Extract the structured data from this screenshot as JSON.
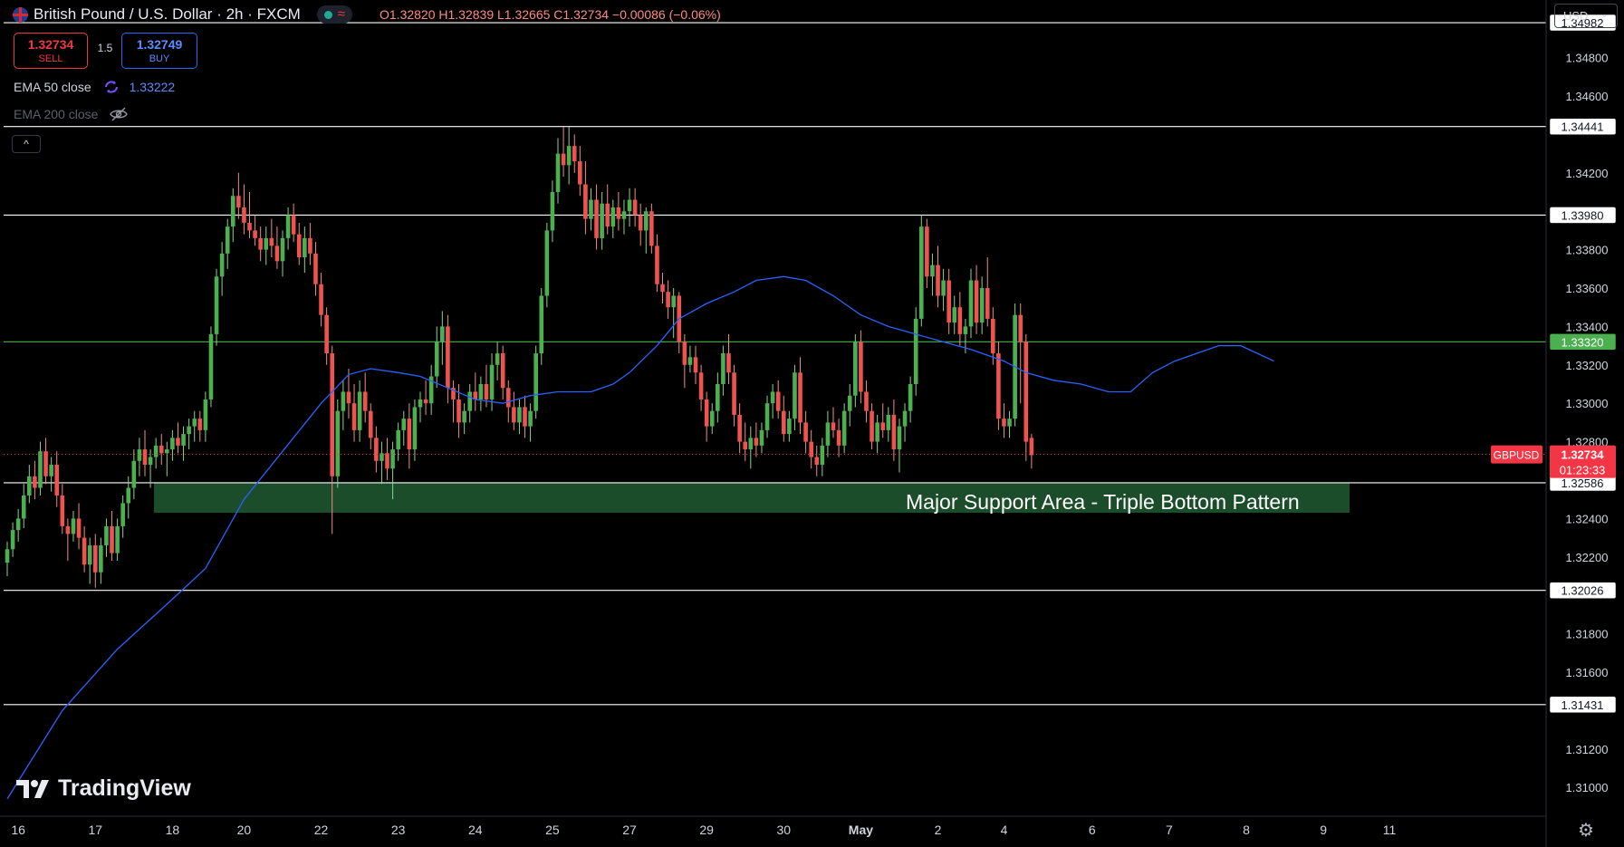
{
  "header": {
    "symbol_title": "British Pound / U.S. Dollar · 2h · FXCM",
    "ohlc_o": "O1.32820",
    "ohlc_h": "H1.32839",
    "ohlc_l": "L1.32665",
    "ohlc_c": "C1.32734",
    "ohlc_change": "−0.00086 (−0.06%)",
    "status_icon": "market-open-dot",
    "wave_icon": "wave-icon"
  },
  "trade": {
    "sell_price": "1.32734",
    "sell_label": "SELL",
    "spread": "1.5",
    "buy_price": "1.32749",
    "buy_label": "BUY"
  },
  "indicators": [
    {
      "name": "EMA 50 close",
      "value": "1.33222",
      "icon": "sync-icon",
      "color": "#2962ff"
    },
    {
      "name": "EMA 200 close",
      "value": "",
      "icon": "eye-hidden-icon",
      "color": "#5d606b"
    }
  ],
  "currency": "USD",
  "branding": "TradingView",
  "colors": {
    "up": "#26a69a",
    "up_fill": "#4caf50",
    "down": "#ef5350",
    "ema": "#2962ff",
    "support": "#1b4d2a",
    "price_tag": "#f23645"
  },
  "chart_data": {
    "type": "candlestick",
    "title": "British Pound / U.S. Dollar · 2h · FXCM",
    "ylim": [
      1.3085,
      1.351
    ],
    "y_ticks": [
      "1.34800",
      "1.34600",
      "1.34200",
      "1.33800",
      "1.33600",
      "1.33400",
      "1.33200",
      "1.33000",
      "1.32800",
      "1.32400",
      "1.32200",
      "1.31800",
      "1.31600",
      "1.31200",
      "1.31000"
    ],
    "y_tick_values": [
      1.348,
      1.346,
      1.342,
      1.338,
      1.336,
      1.334,
      1.332,
      1.33,
      1.328,
      1.324,
      1.322,
      1.318,
      1.316,
      1.312,
      1.31
    ],
    "x_ticks": [
      "16",
      "17",
      "18",
      "20",
      "22",
      "23",
      "24",
      "25",
      "27",
      "29",
      "30",
      "May",
      "2",
      "4",
      "6",
      "7",
      "8",
      "9",
      "11"
    ],
    "x_tick_index": [
      2,
      16,
      30,
      43,
      57,
      71,
      85,
      99,
      113,
      127,
      141,
      155,
      169,
      181,
      197,
      211,
      225,
      239,
      251
    ],
    "horizontal_levels": [
      {
        "value": 1.34982,
        "label": "1.34982",
        "color": "#ffffff"
      },
      {
        "value": 1.34441,
        "label": "1.34441",
        "color": "#ffffff"
      },
      {
        "value": 1.3398,
        "label": "1.33980",
        "color": "#ffffff"
      },
      {
        "value": 1.3332,
        "label": "1.33320",
        "color": "#4caf50"
      },
      {
        "value": 1.32586,
        "label": "1.32586",
        "color": "#ffffff"
      },
      {
        "value": 1.32026,
        "label": "1.32026",
        "color": "#ffffff"
      },
      {
        "value": 1.31431,
        "label": "1.31431",
        "color": "#ffffff"
      }
    ],
    "current_price": {
      "symbol": "GBPUSD",
      "value": 1.32734,
      "label": "1.32734",
      "countdown": "01:23:33"
    },
    "support_zone": {
      "from": 1.3243,
      "to": 1.32586,
      "label": "Major Support Area - Triple Bottom Pattern"
    },
    "candles": [
      [
        1.3217,
        1.3228,
        1.321,
        1.3224
      ],
      [
        1.3224,
        1.3238,
        1.322,
        1.3234
      ],
      [
        1.3234,
        1.3245,
        1.3228,
        1.324
      ],
      [
        1.324,
        1.3258,
        1.3235,
        1.3252
      ],
      [
        1.3252,
        1.3268,
        1.3248,
        1.3262
      ],
      [
        1.3262,
        1.327,
        1.325,
        1.3256
      ],
      [
        1.3256,
        1.328,
        1.3252,
        1.3275
      ],
      [
        1.3275,
        1.3282,
        1.3258,
        1.3262
      ],
      [
        1.3262,
        1.3272,
        1.3254,
        1.3268
      ],
      [
        1.3268,
        1.3275,
        1.3246,
        1.3252
      ],
      [
        1.3252,
        1.3258,
        1.3232,
        1.3236
      ],
      [
        1.3236,
        1.324,
        1.3218,
        1.3232
      ],
      [
        1.3232,
        1.3244,
        1.3228,
        1.324
      ],
      [
        1.324,
        1.3248,
        1.3224,
        1.323
      ],
      [
        1.323,
        1.3236,
        1.3212,
        1.3216
      ],
      [
        1.3216,
        1.323,
        1.3206,
        1.3226
      ],
      [
        1.3226,
        1.3232,
        1.3204,
        1.3212
      ],
      [
        1.3212,
        1.323,
        1.3206,
        1.3226
      ],
      [
        1.3226,
        1.324,
        1.322,
        1.3236
      ],
      [
        1.3236,
        1.3244,
        1.3218,
        1.3222
      ],
      [
        1.3222,
        1.324,
        1.3218,
        1.3236
      ],
      [
        1.3236,
        1.3252,
        1.323,
        1.3248
      ],
      [
        1.3248,
        1.3262,
        1.324,
        1.3256
      ],
      [
        1.3256,
        1.3276,
        1.325,
        1.327
      ],
      [
        1.327,
        1.3282,
        1.3262,
        1.3276
      ],
      [
        1.3276,
        1.3286,
        1.3262,
        1.3268
      ],
      [
        1.3268,
        1.3276,
        1.3256,
        1.3272
      ],
      [
        1.3272,
        1.3282,
        1.3266,
        1.3278
      ],
      [
        1.3278,
        1.3284,
        1.3268,
        1.3274
      ],
      [
        1.3274,
        1.328,
        1.3262,
        1.3276
      ],
      [
        1.3276,
        1.3286,
        1.327,
        1.3282
      ],
      [
        1.3282,
        1.329,
        1.3274,
        1.3278
      ],
      [
        1.3278,
        1.3288,
        1.327,
        1.3284
      ],
      [
        1.3284,
        1.3292,
        1.3276,
        1.3288
      ],
      [
        1.3288,
        1.3296,
        1.328,
        1.3292
      ],
      [
        1.3292,
        1.3296,
        1.328,
        1.3286
      ],
      [
        1.3286,
        1.3306,
        1.328,
        1.3302
      ],
      [
        1.3302,
        1.334,
        1.3298,
        1.3336
      ],
      [
        1.3336,
        1.337,
        1.333,
        1.3366
      ],
      [
        1.3366,
        1.3384,
        1.3356,
        1.3378
      ],
      [
        1.3378,
        1.3396,
        1.337,
        1.3392
      ],
      [
        1.3392,
        1.3412,
        1.3384,
        1.3408
      ],
      [
        1.3408,
        1.342,
        1.3396,
        1.3402
      ],
      [
        1.3402,
        1.3414,
        1.3388,
        1.3394
      ],
      [
        1.3394,
        1.341,
        1.3386,
        1.339
      ],
      [
        1.339,
        1.3398,
        1.3382,
        1.3386
      ],
      [
        1.3386,
        1.3392,
        1.3374,
        1.338
      ],
      [
        1.338,
        1.3392,
        1.3372,
        1.3386
      ],
      [
        1.3386,
        1.3396,
        1.3376,
        1.3382
      ],
      [
        1.3382,
        1.3392,
        1.337,
        1.3374
      ],
      [
        1.3374,
        1.339,
        1.3366,
        1.3386
      ],
      [
        1.3386,
        1.3402,
        1.338,
        1.3398
      ],
      [
        1.3398,
        1.3404,
        1.3384,
        1.3388
      ],
      [
        1.3388,
        1.3394,
        1.3372,
        1.3376
      ],
      [
        1.3376,
        1.3392,
        1.3368,
        1.3386
      ],
      [
        1.3386,
        1.3394,
        1.3372,
        1.3378
      ],
      [
        1.3378,
        1.3384,
        1.3356,
        1.3362
      ],
      [
        1.3362,
        1.3368,
        1.334,
        1.3346
      ],
      [
        1.3346,
        1.335,
        1.332,
        1.3326
      ],
      [
        1.3326,
        1.333,
        1.3232,
        1.3262
      ],
      [
        1.3262,
        1.3302,
        1.3256,
        1.3296
      ],
      [
        1.3296,
        1.3312,
        1.3286,
        1.3306
      ],
      [
        1.3306,
        1.3318,
        1.3292,
        1.33
      ],
      [
        1.33,
        1.331,
        1.328,
        1.3286
      ],
      [
        1.3286,
        1.3312,
        1.328,
        1.3306
      ],
      [
        1.3306,
        1.3316,
        1.329,
        1.3296
      ],
      [
        1.3296,
        1.33,
        1.3276,
        1.3282
      ],
      [
        1.3282,
        1.3288,
        1.3264,
        1.327
      ],
      [
        1.327,
        1.328,
        1.3258,
        1.3274
      ],
      [
        1.3274,
        1.3282,
        1.326,
        1.3266
      ],
      [
        1.3266,
        1.328,
        1.325,
        1.3276
      ],
      [
        1.3276,
        1.329,
        1.327,
        1.3286
      ],
      [
        1.3286,
        1.3296,
        1.3278,
        1.3292
      ],
      [
        1.3292,
        1.33,
        1.3266,
        1.3276
      ],
      [
        1.3276,
        1.3302,
        1.327,
        1.3298
      ],
      [
        1.3298,
        1.3306,
        1.329,
        1.3302
      ],
      [
        1.3302,
        1.3312,
        1.3294,
        1.33
      ],
      [
        1.33,
        1.332,
        1.3294,
        1.3314
      ],
      [
        1.3314,
        1.334,
        1.3308,
        1.3332
      ],
      [
        1.3332,
        1.3348,
        1.332,
        1.334
      ],
      [
        1.334,
        1.3346,
        1.33,
        1.3308
      ],
      [
        1.3308,
        1.3312,
        1.329,
        1.3302
      ],
      [
        1.3302,
        1.331,
        1.3282,
        1.329
      ],
      [
        1.329,
        1.33,
        1.3284,
        1.3296
      ],
      [
        1.3296,
        1.331,
        1.329,
        1.3306
      ],
      [
        1.3306,
        1.3316,
        1.3296,
        1.3302
      ],
      [
        1.3302,
        1.3314,
        1.3296,
        1.331
      ],
      [
        1.331,
        1.332,
        1.3298,
        1.3302
      ],
      [
        1.3302,
        1.3326,
        1.3296,
        1.332
      ],
      [
        1.332,
        1.3332,
        1.3312,
        1.3326
      ],
      [
        1.3326,
        1.333,
        1.3302,
        1.3308
      ],
      [
        1.3308,
        1.3312,
        1.329,
        1.3298
      ],
      [
        1.3298,
        1.3306,
        1.3286,
        1.329
      ],
      [
        1.329,
        1.3302,
        1.3284,
        1.3298
      ],
      [
        1.3298,
        1.3304,
        1.3282,
        1.3288
      ],
      [
        1.3288,
        1.33,
        1.328,
        1.3296
      ],
      [
        1.3296,
        1.333,
        1.3292,
        1.3326
      ],
      [
        1.3326,
        1.336,
        1.332,
        1.3356
      ],
      [
        1.3356,
        1.3394,
        1.335,
        1.339
      ],
      [
        1.339,
        1.3416,
        1.3384,
        1.341
      ],
      [
        1.341,
        1.3438,
        1.3404,
        1.343
      ],
      [
        1.343,
        1.3444,
        1.3418,
        1.3424
      ],
      [
        1.3424,
        1.3444,
        1.3414,
        1.3434
      ],
      [
        1.3434,
        1.344,
        1.342,
        1.3426
      ],
      [
        1.3426,
        1.3434,
        1.3408,
        1.3414
      ],
      [
        1.3414,
        1.3426,
        1.3388,
        1.3396
      ],
      [
        1.3396,
        1.3412,
        1.339,
        1.3406
      ],
      [
        1.3406,
        1.3414,
        1.338,
        1.3386
      ],
      [
        1.3386,
        1.341,
        1.338,
        1.3404
      ],
      [
        1.3404,
        1.3414,
        1.3388,
        1.3392
      ],
      [
        1.3392,
        1.3406,
        1.3386,
        1.3402
      ],
      [
        1.3402,
        1.341,
        1.339,
        1.3396
      ],
      [
        1.3396,
        1.3406,
        1.3388,
        1.34
      ],
      [
        1.34,
        1.3412,
        1.3392,
        1.3406
      ],
      [
        1.3406,
        1.3412,
        1.3392,
        1.3398
      ],
      [
        1.3398,
        1.3404,
        1.3382,
        1.339
      ],
      [
        1.339,
        1.3402,
        1.3378,
        1.34
      ],
      [
        1.34,
        1.3404,
        1.3378,
        1.3382
      ],
      [
        1.3382,
        1.3388,
        1.3358,
        1.3362
      ],
      [
        1.3362,
        1.3368,
        1.3352,
        1.3358
      ],
      [
        1.3358,
        1.3364,
        1.3344,
        1.335
      ],
      [
        1.335,
        1.336,
        1.3334,
        1.3356
      ],
      [
        1.3356,
        1.3358,
        1.3326,
        1.3332
      ],
      [
        1.3332,
        1.3336,
        1.3308,
        1.332
      ],
      [
        1.332,
        1.333,
        1.3316,
        1.3324
      ],
      [
        1.3324,
        1.333,
        1.331,
        1.3316
      ],
      [
        1.3316,
        1.332,
        1.3296,
        1.3302
      ],
      [
        1.3302,
        1.3306,
        1.328,
        1.3288
      ],
      [
        1.3288,
        1.33,
        1.3284,
        1.3296
      ],
      [
        1.3296,
        1.3316,
        1.329,
        1.331
      ],
      [
        1.331,
        1.333,
        1.3304,
        1.3326
      ],
      [
        1.3326,
        1.3336,
        1.331,
        1.3316
      ],
      [
        1.3316,
        1.332,
        1.3288,
        1.3294
      ],
      [
        1.3294,
        1.33,
        1.3274,
        1.328
      ],
      [
        1.328,
        1.329,
        1.327,
        1.3276
      ],
      [
        1.3276,
        1.3288,
        1.3266,
        1.3282
      ],
      [
        1.3282,
        1.329,
        1.3272,
        1.3278
      ],
      [
        1.3278,
        1.329,
        1.3274,
        1.3286
      ],
      [
        1.3286,
        1.3304,
        1.3282,
        1.33
      ],
      [
        1.33,
        1.331,
        1.3292,
        1.3306
      ],
      [
        1.3306,
        1.3312,
        1.3292,
        1.3296
      ],
      [
        1.3296,
        1.3304,
        1.328,
        1.3284
      ],
      [
        1.3284,
        1.3296,
        1.328,
        1.3292
      ],
      [
        1.3292,
        1.332,
        1.3286,
        1.3316
      ],
      [
        1.3316,
        1.3324,
        1.3284,
        1.329
      ],
      [
        1.329,
        1.3296,
        1.3274,
        1.328
      ],
      [
        1.328,
        1.3286,
        1.3266,
        1.3272
      ],
      [
        1.3272,
        1.3278,
        1.3262,
        1.3268
      ],
      [
        1.3268,
        1.3282,
        1.3262,
        1.3278
      ],
      [
        1.3278,
        1.3296,
        1.3272,
        1.329
      ],
      [
        1.329,
        1.3298,
        1.3282,
        1.3286
      ],
      [
        1.3286,
        1.3292,
        1.3272,
        1.3278
      ],
      [
        1.3278,
        1.33,
        1.3274,
        1.3296
      ],
      [
        1.3296,
        1.331,
        1.3288,
        1.3304
      ],
      [
        1.3304,
        1.3336,
        1.3298,
        1.3332
      ],
      [
        1.3332,
        1.3338,
        1.33,
        1.3306
      ],
      [
        1.3306,
        1.3312,
        1.329,
        1.3296
      ],
      [
        1.3296,
        1.33,
        1.3276,
        1.328
      ],
      [
        1.328,
        1.3294,
        1.3274,
        1.329
      ],
      [
        1.329,
        1.33,
        1.3282,
        1.3286
      ],
      [
        1.3286,
        1.3298,
        1.328,
        1.3294
      ],
      [
        1.3294,
        1.3302,
        1.327,
        1.3276
      ],
      [
        1.3276,
        1.3292,
        1.3264,
        1.3288
      ],
      [
        1.3288,
        1.33,
        1.328,
        1.3296
      ],
      [
        1.3296,
        1.3314,
        1.329,
        1.331
      ],
      [
        1.331,
        1.335,
        1.3304,
        1.3344
      ],
      [
        1.3344,
        1.3398,
        1.334,
        1.3392
      ],
      [
        1.3392,
        1.3396,
        1.336,
        1.3366
      ],
      [
        1.3366,
        1.3378,
        1.3356,
        1.3372
      ],
      [
        1.3372,
        1.3382,
        1.335,
        1.3356
      ],
      [
        1.3356,
        1.337,
        1.3348,
        1.3364
      ],
      [
        1.3364,
        1.337,
        1.3336,
        1.3342
      ],
      [
        1.3342,
        1.3356,
        1.3336,
        1.335
      ],
      [
        1.335,
        1.3358,
        1.333,
        1.3336
      ],
      [
        1.3336,
        1.3344,
        1.3326,
        1.334
      ],
      [
        1.334,
        1.337,
        1.3334,
        1.3364
      ],
      [
        1.3364,
        1.3372,
        1.3336,
        1.3342
      ],
      [
        1.3342,
        1.3366,
        1.3336,
        1.336
      ],
      [
        1.336,
        1.3376,
        1.334,
        1.3344
      ],
      [
        1.3344,
        1.335,
        1.332,
        1.3326
      ],
      [
        1.3326,
        1.3332,
        1.3286,
        1.3292
      ],
      [
        1.3292,
        1.33,
        1.3282,
        1.3288
      ],
      [
        1.3288,
        1.3296,
        1.3282,
        1.3292
      ],
      [
        1.3292,
        1.3352,
        1.3288,
        1.3346
      ],
      [
        1.3346,
        1.3352,
        1.33,
        1.3332
      ],
      [
        1.3332,
        1.3336,
        1.327,
        1.328
      ],
      [
        1.3282,
        1.3284,
        1.3266,
        1.3273
      ]
    ],
    "ema50": [
      [
        0,
        1.3094
      ],
      [
        10,
        1.314
      ],
      [
        20,
        1.3172
      ],
      [
        30,
        1.3198
      ],
      [
        36,
        1.3214
      ],
      [
        43,
        1.325
      ],
      [
        50,
        1.3275
      ],
      [
        57,
        1.33
      ],
      [
        62,
        1.3315
      ],
      [
        66,
        1.3318
      ],
      [
        71,
        1.3316
      ],
      [
        75,
        1.3314
      ],
      [
        80,
        1.3308
      ],
      [
        85,
        1.3302
      ],
      [
        90,
        1.33
      ],
      [
        95,
        1.3304
      ],
      [
        100,
        1.3306
      ],
      [
        106,
        1.3306
      ],
      [
        110,
        1.331
      ],
      [
        113,
        1.3316
      ],
      [
        118,
        1.333
      ],
      [
        122,
        1.3344
      ],
      [
        127,
        1.3352
      ],
      [
        132,
        1.3358
      ],
      [
        136,
        1.3364
      ],
      [
        141,
        1.3366
      ],
      [
        145,
        1.3364
      ],
      [
        150,
        1.3356
      ],
      [
        155,
        1.3346
      ],
      [
        160,
        1.334
      ],
      [
        165,
        1.3336
      ],
      [
        170,
        1.3332
      ],
      [
        175,
        1.3328
      ],
      [
        181,
        1.3322
      ],
      [
        185,
        1.3316
      ],
      [
        190,
        1.3312
      ],
      [
        195,
        1.331
      ],
      [
        200,
        1.3306
      ],
      [
        204,
        1.3306
      ],
      [
        208,
        1.3316
      ],
      [
        212,
        1.3322
      ],
      [
        216,
        1.3326
      ],
      [
        220,
        1.333
      ],
      [
        224,
        1.333
      ],
      [
        227,
        1.3326
      ],
      [
        230,
        1.3322
      ]
    ]
  }
}
